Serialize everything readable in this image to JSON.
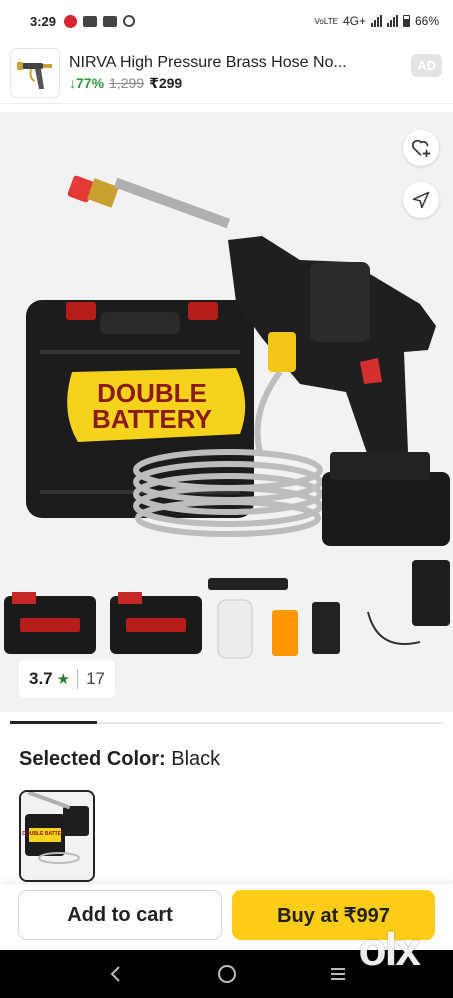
{
  "status_bar": {
    "time": "3:29",
    "network": "4G+",
    "volte": "VoLTE",
    "battery": "66%"
  },
  "ad": {
    "title": "NIRVA High Pressure Brass Hose No...",
    "discount": "↓77%",
    "mrp": "1,299",
    "price": "₹299",
    "tag": "AD"
  },
  "product": {
    "box_text_line1": "DOUBLE",
    "box_text_line2": "BATTERY",
    "rating": "3.7",
    "rating_star": "★",
    "rating_count": "17"
  },
  "carousel": {
    "active_fraction": 0.2
  },
  "color_selection": {
    "label": "Selected Color:",
    "value": "Black",
    "swatch_text": "DOUBLE BATTERY"
  },
  "actions": {
    "add_to_cart": "Add to cart",
    "buy": "Buy at ₹997"
  },
  "watermark": "olx",
  "colors": {
    "accent_yellow": "#ffcd17",
    "discount_green": "#2e9a3b",
    "star_green": "#2e7d32",
    "product_bg": "#f2f2f2"
  }
}
